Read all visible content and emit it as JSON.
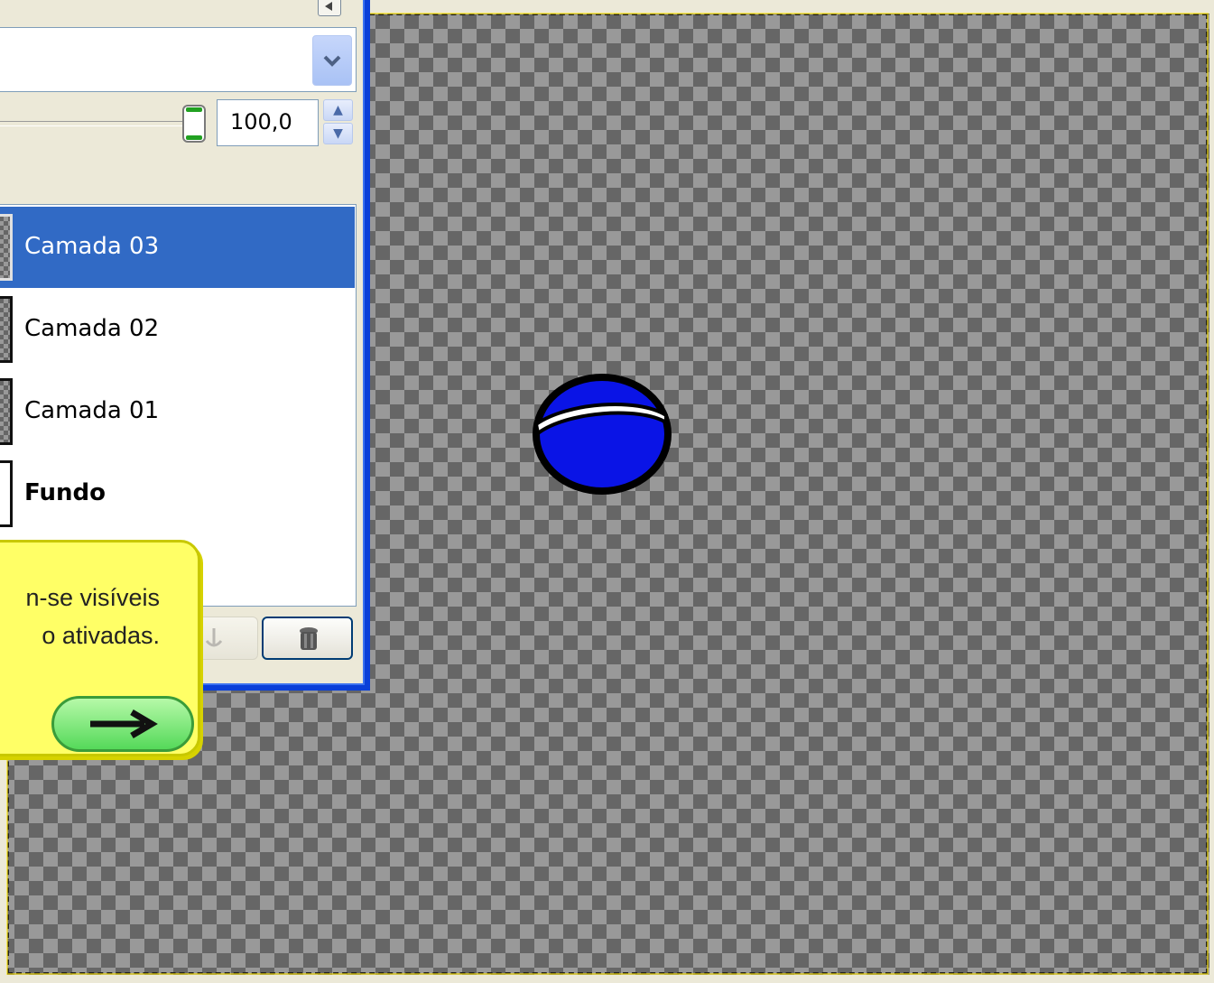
{
  "dialog": {
    "mode_value": "",
    "combo_arrow_icon": "chevron-down-icon",
    "opacity_value": "100,0",
    "opacity_level": 100,
    "layers": [
      {
        "name": "Camada 03",
        "selected": true,
        "bold": false,
        "thumb": "checker"
      },
      {
        "name": "Camada 02",
        "selected": false,
        "bold": false,
        "thumb": "checker"
      },
      {
        "name": "Camada 01",
        "selected": false,
        "bold": false,
        "thumb": "checker"
      },
      {
        "name": "Fundo",
        "selected": false,
        "bold": true,
        "thumb": "white"
      }
    ],
    "footer_icons": [
      "anchor-icon",
      "trash-icon"
    ],
    "accent_color": "#316ac5",
    "frame_color": "#0a3fd8"
  },
  "tooltip": {
    "line1": "n-se visíveis",
    "line2": "o ativadas.",
    "next_icon": "arrow-right-icon",
    "background_color": "#ffff66"
  },
  "canvas": {
    "background": "transparency-checkerboard",
    "object": "blue-ball",
    "object_color": "#0a14e6"
  }
}
